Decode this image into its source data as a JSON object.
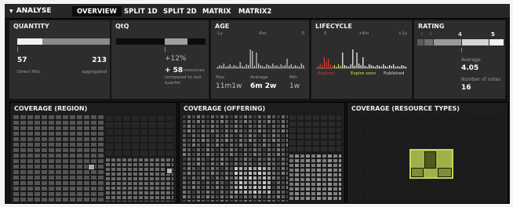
{
  "nav": {
    "analyse_label": "ANALYSE",
    "tabs": [
      "OVERVIEW",
      "SPLIT 1D",
      "SPLIT 2D",
      "MATRIX",
      "MATRIX2"
    ],
    "active_tab": "OVERVIEW"
  },
  "quantity": {
    "title": "QUANTITY",
    "left_value": "57",
    "right_value": "213",
    "left_caption": "Direct Hits",
    "right_caption": "aggregated",
    "fill_fraction": 0.27
  },
  "qtq": {
    "title": "QtQ",
    "pct": "+12%",
    "delta": "+ 58",
    "delta_unit": "resources",
    "delta_caption": "compared to last quarter"
  },
  "age": {
    "title": "AGE",
    "axis_labels": [
      "-1y",
      "-6m",
      "0"
    ],
    "stats": [
      {
        "label": "Max",
        "value": "11m1w"
      },
      {
        "label": "Average",
        "value": "6m 2w"
      },
      {
        "label": "Min",
        "value": "1w"
      }
    ]
  },
  "lifecycle": {
    "title": "LIFECYCLE",
    "axis_labels": [
      "0",
      "+6m",
      "+1y"
    ],
    "legend": [
      "Expired",
      "Expire soon",
      "Published"
    ],
    "colors": {
      "expired": "#e8312a",
      "expire_soon": "#d7e04a",
      "published": "#ffffff"
    }
  },
  "rating": {
    "title": "RATING",
    "scale": [
      "2",
      "3",
      "4",
      "5"
    ],
    "average_label": "Average",
    "average_value": "4.05",
    "votes_label": "Number of votes",
    "votes_value": "16"
  },
  "coverage": [
    {
      "title": "COVERAGE (REGION)"
    },
    {
      "title": "COVERAGE (OFFERING)"
    },
    {
      "title": "COVERAGE (RESOURCE TYPES)"
    }
  ],
  "colors": {
    "highlight": "#9fb24a",
    "highlight_dark": "#4f5a1c"
  }
}
